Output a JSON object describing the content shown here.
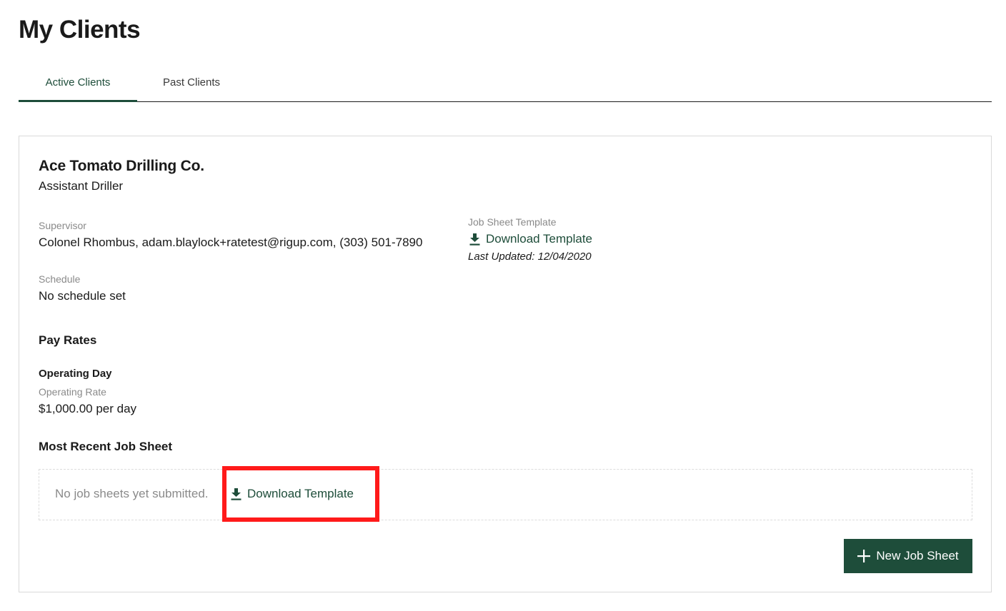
{
  "page": {
    "title": "My Clients"
  },
  "tabs": [
    {
      "label": "Active Clients",
      "active": true
    },
    {
      "label": "Past Clients",
      "active": false
    }
  ],
  "client": {
    "company": "Ace Tomato Drilling Co.",
    "role": "Assistant Driller",
    "supervisor": {
      "label": "Supervisor",
      "value": "Colonel Rhombus, adam.blaylock+ratetest@rigup.com, (303) 501-7890"
    },
    "schedule": {
      "label": "Schedule",
      "value": "No schedule set"
    },
    "job_sheet_template": {
      "label": "Job Sheet Template",
      "download_label": "Download Template",
      "download_icon": "download-icon",
      "last_updated": "Last Updated: 12/04/2020"
    },
    "pay_rates": {
      "title": "Pay Rates",
      "items": [
        {
          "name": "Operating Day",
          "rate_label": "Operating Rate",
          "rate_value": "$1,000.00 per day"
        }
      ]
    },
    "recent_job_sheet": {
      "title": "Most Recent Job Sheet",
      "empty_text": "No job sheets yet submitted.",
      "download_label": "Download Template"
    },
    "new_job_sheet_button": "New Job Sheet"
  },
  "colors": {
    "accent": "#1e4d3a",
    "highlight": "#ff1a1a",
    "muted": "#8a8a8a"
  }
}
